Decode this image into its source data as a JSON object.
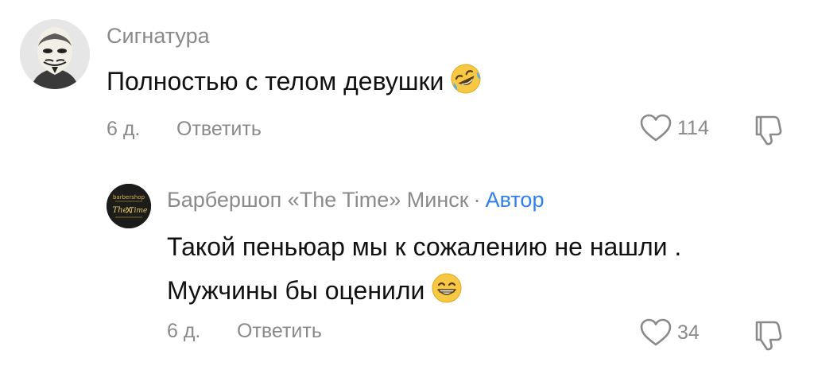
{
  "comments": [
    {
      "author": "Сигнатура",
      "text_lines": [
        "Полностью с телом девушки"
      ],
      "emoji": "rolling-on-floor-laughing-emoji",
      "time": "6 д.",
      "reply_label": "Ответить",
      "likes": "114"
    },
    {
      "author": "Барбершоп «The Time» Минск",
      "separator": "·",
      "author_badge": "Автор",
      "avatar_text": [
        "barbershop",
        "The",
        "X",
        "Time"
      ],
      "text_lines": [
        "Такой пеньюар мы к сожалению не нашли .",
        "Мужчины бы оценили"
      ],
      "emoji": "grinning-face-emoji",
      "time": "6 д.",
      "reply_label": "Ответить",
      "likes": "34"
    }
  ],
  "colors": {
    "muted_text": "#8a8a8a",
    "body_text": "#111111",
    "author_badge": "#2f80ed",
    "emoji_yellow": "#f7c843"
  },
  "icons": {
    "like": "heart-outline-icon",
    "dislike": "thumbs-down-outline-icon"
  }
}
